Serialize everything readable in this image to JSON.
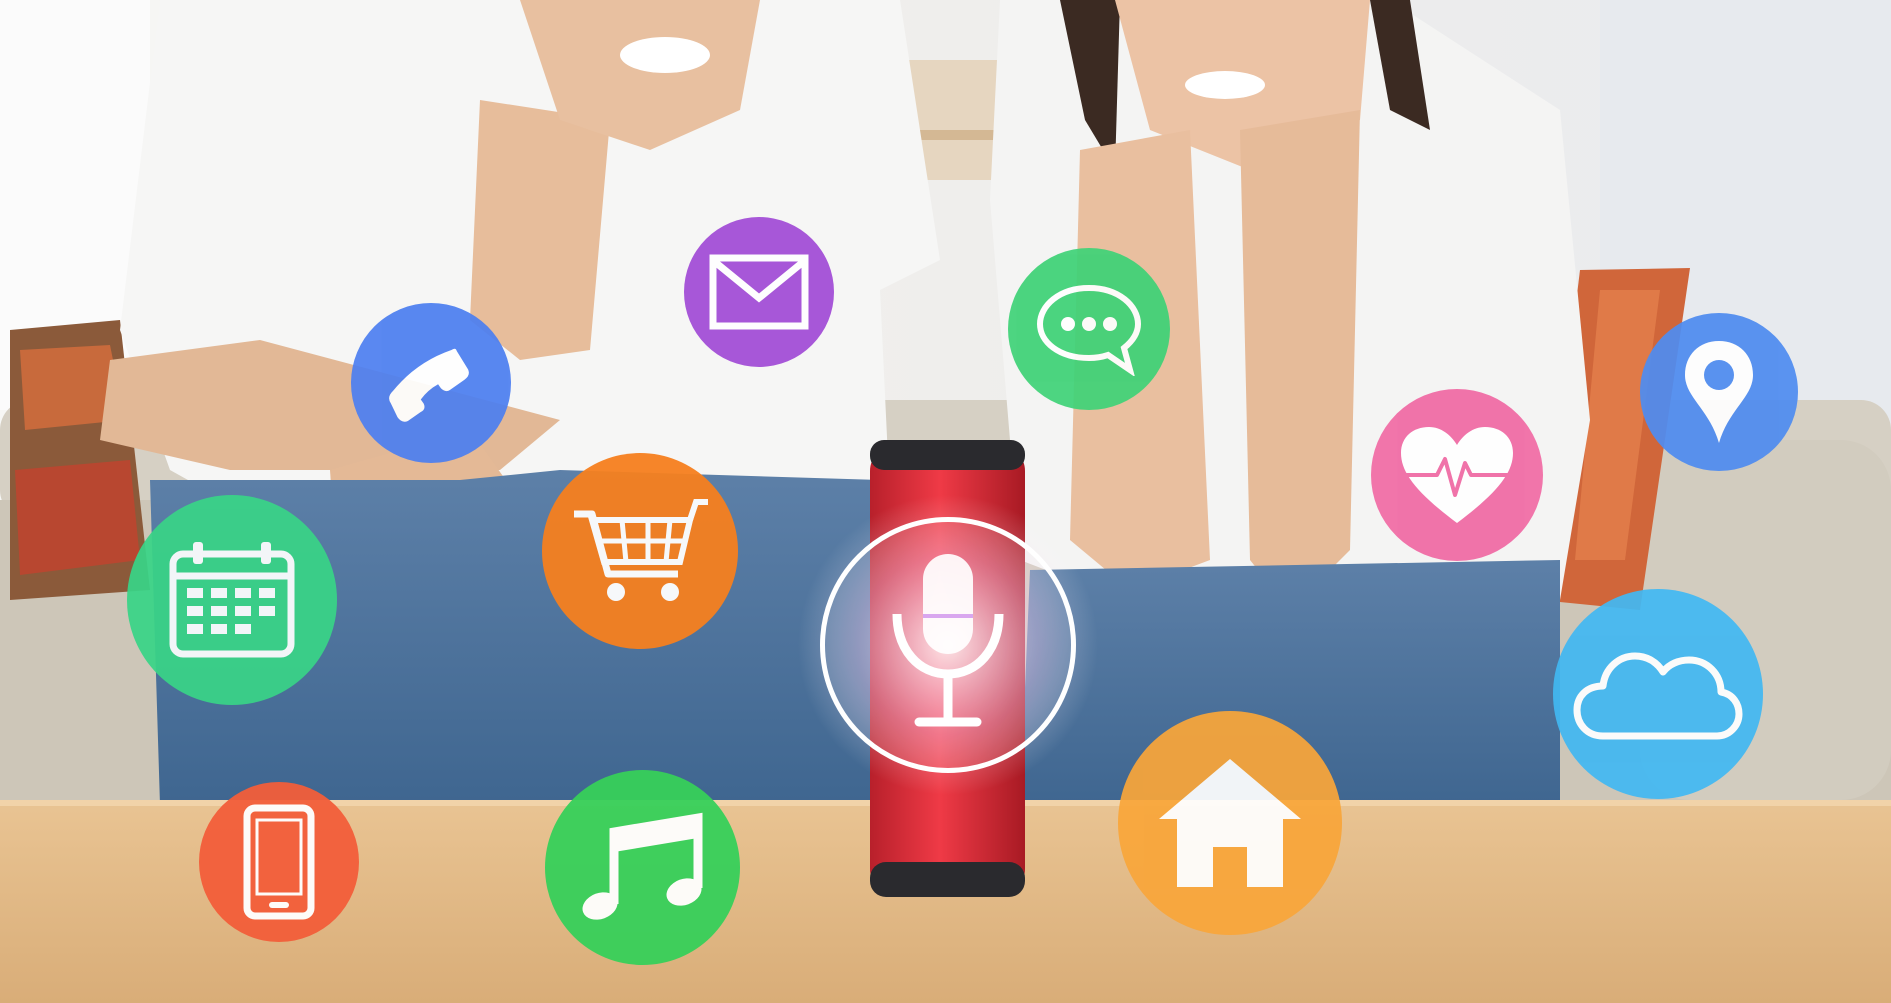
{
  "scene": {
    "description_icons": [
      "phone-icon",
      "mail-icon",
      "chat-icon",
      "location-pin-icon",
      "calendar-icon",
      "shopping-cart-icon",
      "microphone-icon",
      "heart-rate-icon",
      "cloud-icon",
      "smartphone-icon",
      "music-note-icon",
      "home-icon"
    ],
    "colors": {
      "phone": "#4d7ff0",
      "mail": "#a24bd6",
      "chat": "#3fd277",
      "location": "#4f8cf0",
      "calendar": "#39d487",
      "cart": "#f6801f",
      "heart": "#f06aa4",
      "cloud": "#42b8f2",
      "smartphone": "#f35e3a",
      "music": "#37d05a",
      "home": "#f9a63a",
      "speaker_body": "#e2323e",
      "speaker_cap": "#2a2a2e",
      "table": "#e7c08f",
      "sofa": "#d8d2c6",
      "wall": "#f3f3f1",
      "shirt": "#f7f7f7",
      "jeans": "#4a6f98"
    }
  }
}
